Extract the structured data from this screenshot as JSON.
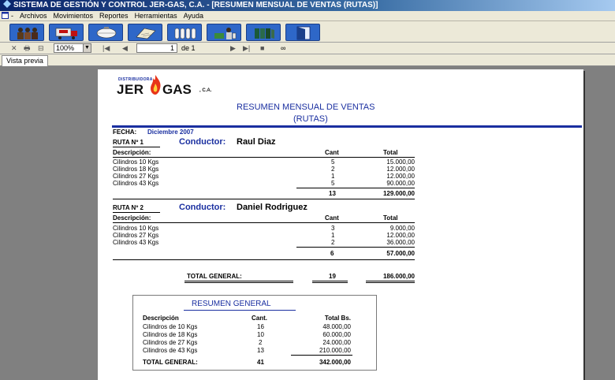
{
  "window": {
    "title": "SISTEMA DE GESTIÓN Y CONTROL JER-GAS, C.A. - [RESUMEN MENSUAL DE VENTAS (RUTAS)]"
  },
  "menu": {
    "items": [
      "Archivos",
      "Movimientos",
      "Reportes",
      "Herramientas",
      "Ayuda"
    ]
  },
  "toolbar": {
    "buttons": [
      "workers-icon",
      "truck-icon",
      "cylinder-icon",
      "document-icon",
      "cylinders-icon",
      "delivery-icon",
      "books-icon",
      "exit-door-icon"
    ]
  },
  "preview_bar": {
    "zoom": "100%",
    "page": "1",
    "page_of": "de 1"
  },
  "tabs": {
    "active": "Vista previa"
  },
  "report": {
    "company_small": "DISTRIBUIDORA",
    "company_jer": "JER",
    "company_gas": "GAS",
    "company_ca": ", C.A.",
    "title": "RESUMEN MENSUAL DE VENTAS",
    "subtitle": "(RUTAS)",
    "fecha_label": "FECHA:",
    "fecha_value": "Diciembre 2007",
    "col_desc": "Descripción:",
    "col_cant": "Cant",
    "col_total": "Total",
    "conductor_label": "Conductor:",
    "routes": [
      {
        "label": "RUTA Nº 1",
        "driver": "Raul Diaz",
        "rows": [
          {
            "desc": "Cilindros 10 Kgs",
            "cant": "5",
            "total": "15.000,00"
          },
          {
            "desc": "Cilindros 18 Kgs",
            "cant": "2",
            "total": "12.000,00"
          },
          {
            "desc": "Cilindros 27 Kgs",
            "cant": "1",
            "total": "12.000,00"
          },
          {
            "desc": "Cilindros 43 Kgs",
            "cant": "5",
            "total": "90.000,00"
          }
        ],
        "sum_cant": "13",
        "sum_total": "129.000,00"
      },
      {
        "label": "RUTA Nº 2",
        "driver": "Daniel Rodriguez",
        "rows": [
          {
            "desc": "Cilindros 10 Kgs",
            "cant": "3",
            "total": "9.000,00"
          },
          {
            "desc": "Cilindros 27 Kgs",
            "cant": "1",
            "total": "12.000,00"
          },
          {
            "desc": "Cilindros 43 Kgs",
            "cant": "2",
            "total": "36.000,00"
          }
        ],
        "sum_cant": "6",
        "sum_total": "57.000,00"
      }
    ],
    "total_general_label": "TOTAL GENERAL:",
    "total_general_cant": "19",
    "total_general_total": "186.000,00",
    "summary": {
      "title": "RESUMEN GENERAL",
      "col_desc": "Descripción",
      "col_cant": "Cant.",
      "col_total": "Total Bs.",
      "rows": [
        {
          "desc": "Cilindros de 10 Kgs",
          "cant": "16",
          "total": "48.000,00"
        },
        {
          "desc": "Cilindros de 18 Kgs",
          "cant": "10",
          "total": "60.000,00"
        },
        {
          "desc": "Cilindros de 27 Kgs",
          "cant": "2",
          "total": "24.000,00"
        },
        {
          "desc": "Cilindros de 43 Kgs",
          "cant": "13",
          "total": "210.000,00"
        }
      ],
      "total_label": "TOTAL GENERAL:",
      "total_cant": "41",
      "total_total": "342.000,00"
    }
  }
}
